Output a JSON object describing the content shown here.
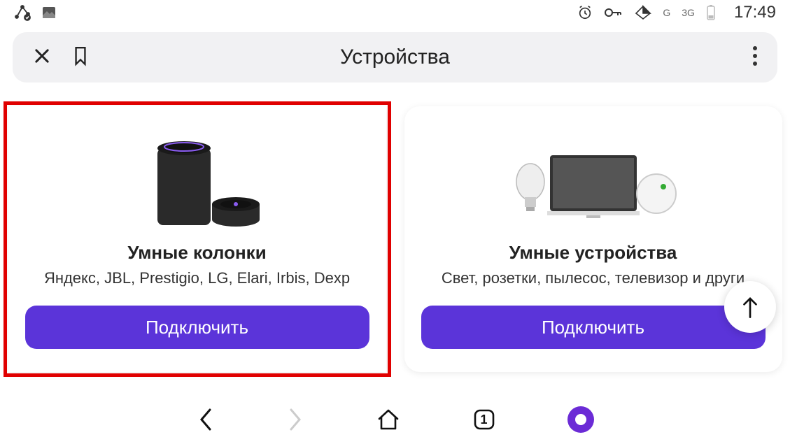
{
  "statusbar": {
    "net1": "G",
    "net2": "3G",
    "time": "17:49"
  },
  "appbar": {
    "title": "Устройства"
  },
  "cards": [
    {
      "title": "Умные колонки",
      "subtitle": "Яндекс, JBL, Prestigio, LG, Elari, Irbis, Dexp",
      "button": "Подключить",
      "highlighted": true
    },
    {
      "title": "Умные устройства",
      "subtitle": "Свет, розетки, пылесос, телевизор и други",
      "button": "Подключить",
      "highlighted": false
    }
  ],
  "bottombar": {
    "tabs_count": "1"
  },
  "colors": {
    "accent": "#5b34d9",
    "highlight": "#e00000"
  }
}
